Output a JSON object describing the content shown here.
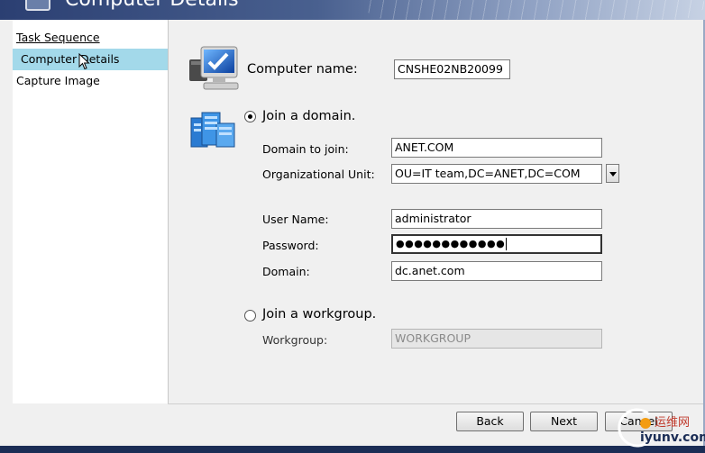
{
  "window": {
    "title": "Computer Details"
  },
  "sidebar": {
    "items": [
      {
        "label": "Task Sequence"
      },
      {
        "label": "Computer Details"
      },
      {
        "label": "Capture Image"
      }
    ]
  },
  "computer": {
    "label": "Computer name:",
    "value": "CNSHE02NB20099"
  },
  "domain_option": {
    "label": "Join a domain.",
    "checked": true
  },
  "domain_to_join": {
    "label": "Domain to join:",
    "value": "ANET.COM"
  },
  "org_unit": {
    "label": "Organizational Unit:",
    "value": "OU=IT team,DC=ANET,DC=COM"
  },
  "user_name": {
    "label": "User Name:",
    "value": "administrator"
  },
  "password": {
    "label": "Password:",
    "value": "●●●●●●●●●●●●"
  },
  "credential_domain": {
    "label": "Domain:",
    "value": "dc.anet.com"
  },
  "workgroup_option": {
    "label": "Join a workgroup.",
    "checked": false
  },
  "workgroup": {
    "label": "Workgroup:",
    "placeholder": "WORKGROUP"
  },
  "buttons": {
    "back": "Back",
    "next": "Next",
    "cancel": "Cancel"
  },
  "watermark": {
    "brand": "iyunv.com",
    "chinese": "运维网"
  },
  "colors": {
    "selection": "#a3d9ea",
    "desktop": "#1b2d55"
  }
}
